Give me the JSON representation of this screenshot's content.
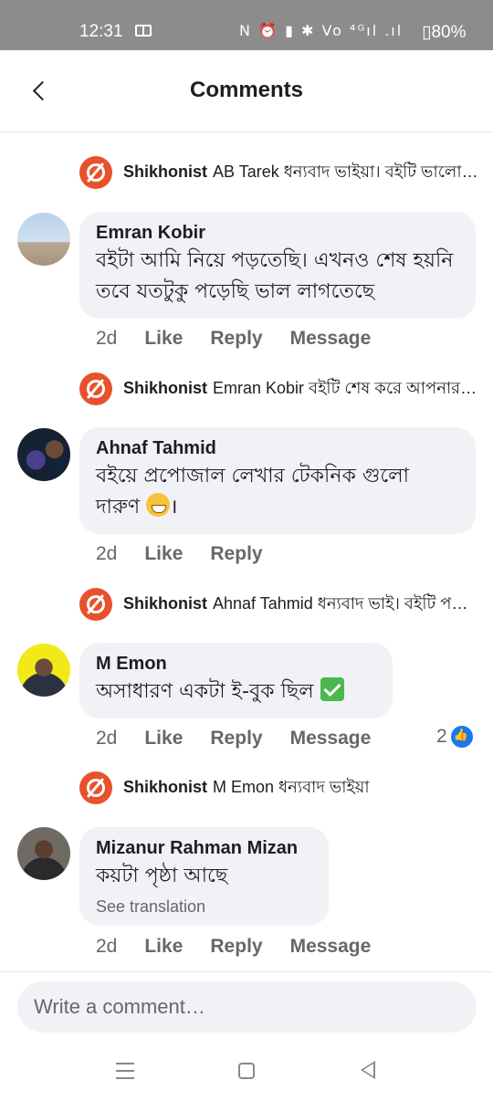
{
  "status_bar": {
    "time": "12:31",
    "icons": "N ⏰ ▮ ✱ Vo ⁴ᴳıl .ıl",
    "battery": "▯80%"
  },
  "header": {
    "title": "Comments"
  },
  "comments": [
    {
      "page_reply": {
        "name": "Shikhonist",
        "text": "AB Tarek ধন্যবাদ ভাইয়া। বইটি ভালো লাগলে জানাবেন"
      }
    },
    {
      "author": "Emran Kobir",
      "text": "বইটা আমি নিয়ে পড়তেছি। এখনও শেষ হয়নি তবে যতটুকু পড়েছি ভাল লাগতেছে",
      "time": "2d",
      "like": "Like",
      "reply": "Reply",
      "message": "Message",
      "page_reply": {
        "name": "Shikhonist",
        "text": "Emran Kobir বইটি শেষ করে আপনার মতামত জানাবেন"
      }
    },
    {
      "author": "Ahnaf Tahmid",
      "text": "বইয়ে প্রপোজাল লেখার টেকনিক গুলো দারুণ",
      "text_end": "।",
      "time": "2d",
      "like": "Like",
      "reply": "Reply",
      "page_reply": {
        "name": "Shikhonist",
        "text": "Ahnaf Tahmid ধন্যবাদ ভাই। বইটি পড়ে কাজে লাগাবেন"
      }
    },
    {
      "author": "M Emon",
      "text": "অসাধারণ একটা ই-বুক  ছিল",
      "time": "2d",
      "like": "Like",
      "reply": "Reply",
      "message": "Message",
      "reaction_count": "2",
      "page_reply": {
        "name": "Shikhonist",
        "text": "M Emon ধন্যবাদ ভাইয়া"
      }
    },
    {
      "author": "Mizanur Rahman Mizan",
      "text": "কয়টা পৃষ্ঠা আছে",
      "see_translation": "See translation",
      "time": "2d",
      "like": "Like",
      "reply": "Reply",
      "message": "Message"
    }
  ],
  "composer": {
    "placeholder": "Write a comment…"
  },
  "colors": {
    "page_avatar": "#e8512b",
    "bubble": "#f0f2f5",
    "like_blue": "#1877f2"
  },
  "icons": [
    "back-icon",
    "shikhonist-logo-icon",
    "like-reaction-icon",
    "grin-emoji-icon",
    "check-mark-emoji-icon",
    "menu-icon",
    "home-icon",
    "nav-back-icon"
  ]
}
